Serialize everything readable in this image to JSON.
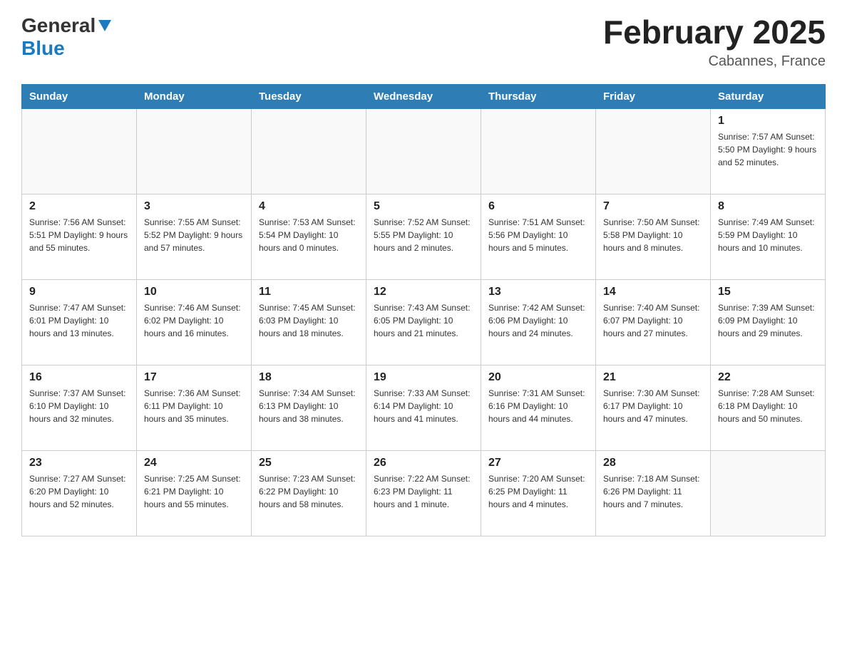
{
  "header": {
    "logo_general": "General",
    "logo_blue": "Blue",
    "title": "February 2025",
    "subtitle": "Cabannes, France"
  },
  "days_of_week": [
    "Sunday",
    "Monday",
    "Tuesday",
    "Wednesday",
    "Thursday",
    "Friday",
    "Saturday"
  ],
  "weeks": [
    [
      {
        "day": "",
        "info": ""
      },
      {
        "day": "",
        "info": ""
      },
      {
        "day": "",
        "info": ""
      },
      {
        "day": "",
        "info": ""
      },
      {
        "day": "",
        "info": ""
      },
      {
        "day": "",
        "info": ""
      },
      {
        "day": "1",
        "info": "Sunrise: 7:57 AM\nSunset: 5:50 PM\nDaylight: 9 hours\nand 52 minutes."
      }
    ],
    [
      {
        "day": "2",
        "info": "Sunrise: 7:56 AM\nSunset: 5:51 PM\nDaylight: 9 hours\nand 55 minutes."
      },
      {
        "day": "3",
        "info": "Sunrise: 7:55 AM\nSunset: 5:52 PM\nDaylight: 9 hours\nand 57 minutes."
      },
      {
        "day": "4",
        "info": "Sunrise: 7:53 AM\nSunset: 5:54 PM\nDaylight: 10 hours\nand 0 minutes."
      },
      {
        "day": "5",
        "info": "Sunrise: 7:52 AM\nSunset: 5:55 PM\nDaylight: 10 hours\nand 2 minutes."
      },
      {
        "day": "6",
        "info": "Sunrise: 7:51 AM\nSunset: 5:56 PM\nDaylight: 10 hours\nand 5 minutes."
      },
      {
        "day": "7",
        "info": "Sunrise: 7:50 AM\nSunset: 5:58 PM\nDaylight: 10 hours\nand 8 minutes."
      },
      {
        "day": "8",
        "info": "Sunrise: 7:49 AM\nSunset: 5:59 PM\nDaylight: 10 hours\nand 10 minutes."
      }
    ],
    [
      {
        "day": "9",
        "info": "Sunrise: 7:47 AM\nSunset: 6:01 PM\nDaylight: 10 hours\nand 13 minutes."
      },
      {
        "day": "10",
        "info": "Sunrise: 7:46 AM\nSunset: 6:02 PM\nDaylight: 10 hours\nand 16 minutes."
      },
      {
        "day": "11",
        "info": "Sunrise: 7:45 AM\nSunset: 6:03 PM\nDaylight: 10 hours\nand 18 minutes."
      },
      {
        "day": "12",
        "info": "Sunrise: 7:43 AM\nSunset: 6:05 PM\nDaylight: 10 hours\nand 21 minutes."
      },
      {
        "day": "13",
        "info": "Sunrise: 7:42 AM\nSunset: 6:06 PM\nDaylight: 10 hours\nand 24 minutes."
      },
      {
        "day": "14",
        "info": "Sunrise: 7:40 AM\nSunset: 6:07 PM\nDaylight: 10 hours\nand 27 minutes."
      },
      {
        "day": "15",
        "info": "Sunrise: 7:39 AM\nSunset: 6:09 PM\nDaylight: 10 hours\nand 29 minutes."
      }
    ],
    [
      {
        "day": "16",
        "info": "Sunrise: 7:37 AM\nSunset: 6:10 PM\nDaylight: 10 hours\nand 32 minutes."
      },
      {
        "day": "17",
        "info": "Sunrise: 7:36 AM\nSunset: 6:11 PM\nDaylight: 10 hours\nand 35 minutes."
      },
      {
        "day": "18",
        "info": "Sunrise: 7:34 AM\nSunset: 6:13 PM\nDaylight: 10 hours\nand 38 minutes."
      },
      {
        "day": "19",
        "info": "Sunrise: 7:33 AM\nSunset: 6:14 PM\nDaylight: 10 hours\nand 41 minutes."
      },
      {
        "day": "20",
        "info": "Sunrise: 7:31 AM\nSunset: 6:16 PM\nDaylight: 10 hours\nand 44 minutes."
      },
      {
        "day": "21",
        "info": "Sunrise: 7:30 AM\nSunset: 6:17 PM\nDaylight: 10 hours\nand 47 minutes."
      },
      {
        "day": "22",
        "info": "Sunrise: 7:28 AM\nSunset: 6:18 PM\nDaylight: 10 hours\nand 50 minutes."
      }
    ],
    [
      {
        "day": "23",
        "info": "Sunrise: 7:27 AM\nSunset: 6:20 PM\nDaylight: 10 hours\nand 52 minutes."
      },
      {
        "day": "24",
        "info": "Sunrise: 7:25 AM\nSunset: 6:21 PM\nDaylight: 10 hours\nand 55 minutes."
      },
      {
        "day": "25",
        "info": "Sunrise: 7:23 AM\nSunset: 6:22 PM\nDaylight: 10 hours\nand 58 minutes."
      },
      {
        "day": "26",
        "info": "Sunrise: 7:22 AM\nSunset: 6:23 PM\nDaylight: 11 hours\nand 1 minute."
      },
      {
        "day": "27",
        "info": "Sunrise: 7:20 AM\nSunset: 6:25 PM\nDaylight: 11 hours\nand 4 minutes."
      },
      {
        "day": "28",
        "info": "Sunrise: 7:18 AM\nSunset: 6:26 PM\nDaylight: 11 hours\nand 7 minutes."
      },
      {
        "day": "",
        "info": ""
      }
    ]
  ]
}
